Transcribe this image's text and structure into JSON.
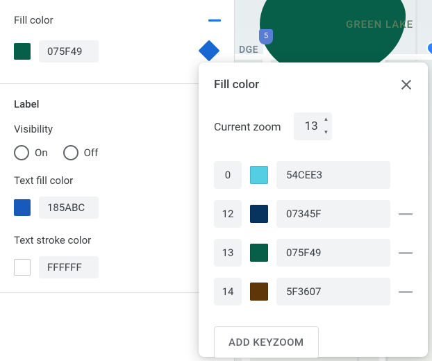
{
  "left_panel": {
    "fill_color": {
      "label": "Fill color",
      "swatch": "#075F49",
      "hex": "075F49"
    },
    "label_section": {
      "title": "Label",
      "visibility_label": "Visibility",
      "visibility_options": {
        "on": "On",
        "off": "Off"
      },
      "text_fill": {
        "label": "Text fill color",
        "swatch": "#185ABC",
        "hex": "185ABC"
      },
      "text_stroke": {
        "label": "Text stroke color",
        "swatch": "#FFFFFF",
        "hex": "FFFFFF"
      }
    }
  },
  "map": {
    "green_lake_label": "GREEN LAKE",
    "dge_label": "DGE",
    "shield": "5"
  },
  "popover": {
    "title": "Fill color",
    "current_zoom_label": "Current zoom",
    "current_zoom_value": "13",
    "stops": [
      {
        "zoom": "0",
        "swatch": "#54CEE3",
        "hex": "54CEE3",
        "removable": false
      },
      {
        "zoom": "12",
        "swatch": "#07345F",
        "hex": "07345F",
        "removable": true
      },
      {
        "zoom": "13",
        "swatch": "#075F49",
        "hex": "075F49",
        "removable": true
      },
      {
        "zoom": "14",
        "swatch": "#5F3607",
        "hex": "5F3607",
        "removable": true
      }
    ],
    "add_button": "ADD KEYZOOM"
  }
}
